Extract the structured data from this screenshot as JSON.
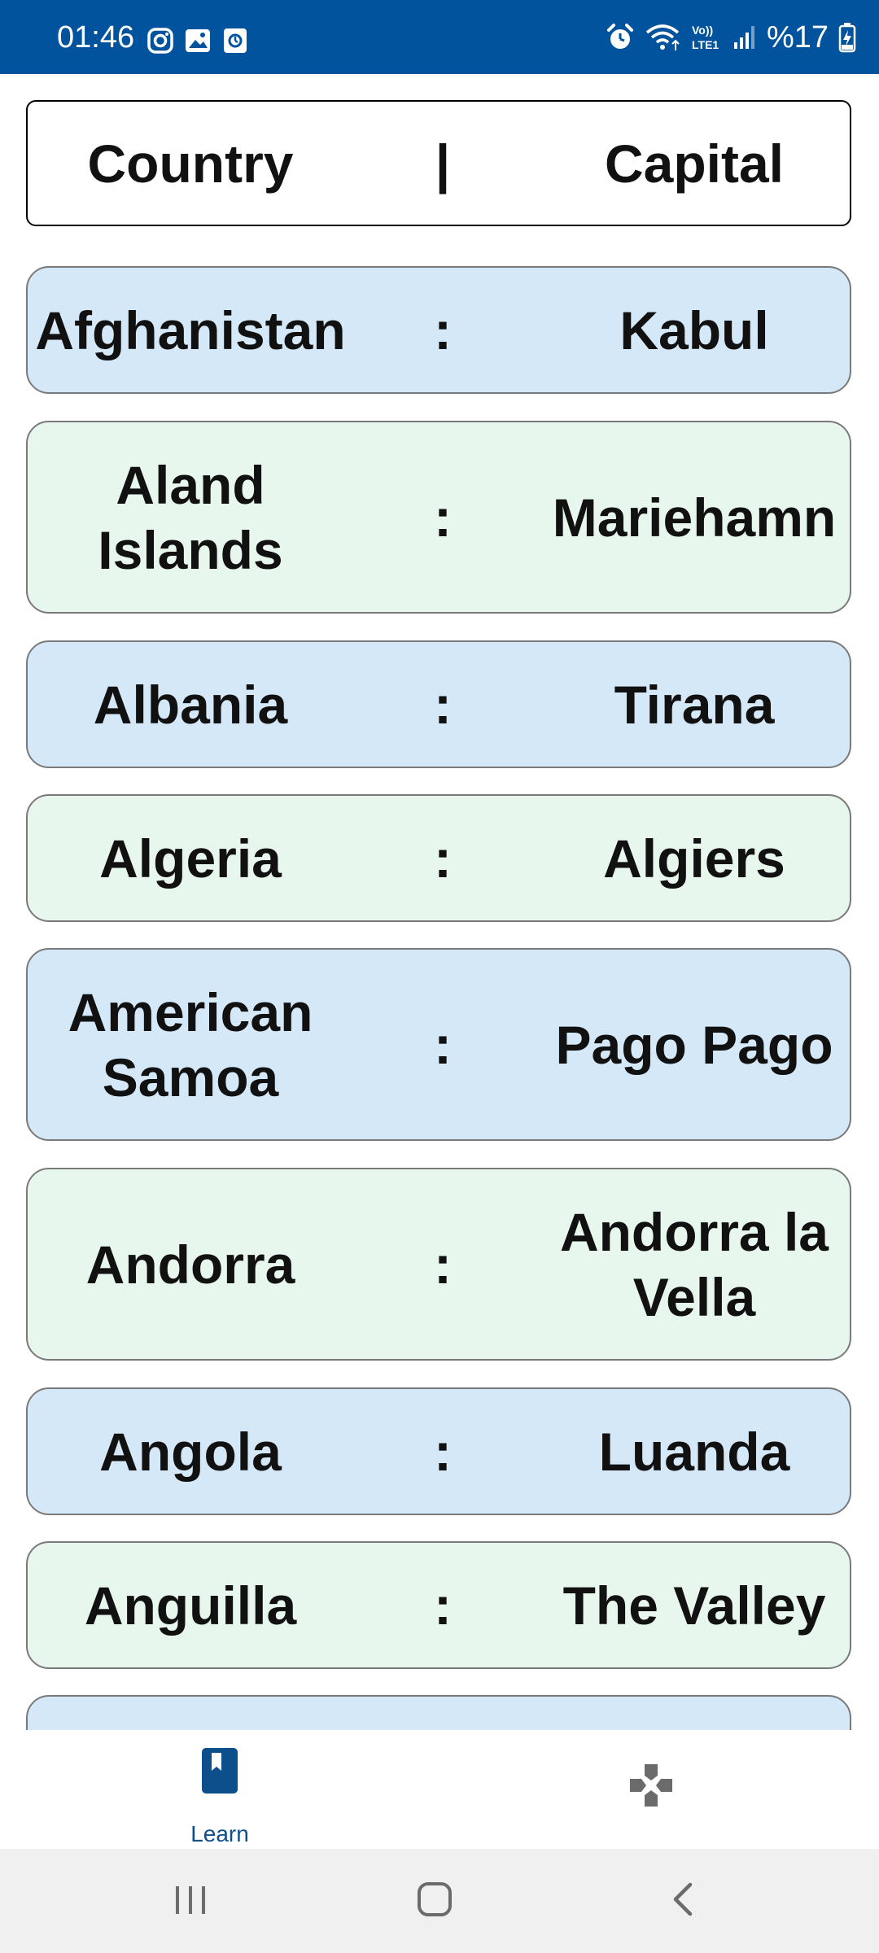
{
  "status_bar": {
    "time": "01:46",
    "battery": "%17",
    "left_icons": [
      "instagram-icon",
      "gallery-icon",
      "screen-record-icon"
    ],
    "right_icons": [
      "alarm-icon",
      "wifi-icon",
      "volte-icon",
      "signal-icon",
      "battery-charging-icon"
    ],
    "volte_label_top": "Vo))",
    "volte_label_bottom": "LTE1",
    "background": "#02539e"
  },
  "header": {
    "country_label": "Country",
    "separator": "|",
    "capital_label": "Capital"
  },
  "rows": [
    {
      "country": "Afghanistan",
      "sep": ":",
      "capital": "Kabul"
    },
    {
      "country": "Aland Islands",
      "sep": ":",
      "capital": "Mariehamn"
    },
    {
      "country": "Albania",
      "sep": ":",
      "capital": "Tirana"
    },
    {
      "country": "Algeria",
      "sep": ":",
      "capital": "Algiers"
    },
    {
      "country": "American Samoa",
      "sep": ":",
      "capital": "Pago Pago"
    },
    {
      "country": "Andorra",
      "sep": ":",
      "capital": "Andorra la Vella"
    },
    {
      "country": "Angola",
      "sep": ":",
      "capital": "Luanda"
    },
    {
      "country": "Anguilla",
      "sep": ":",
      "capital": "The Valley"
    }
  ],
  "colors": {
    "row_blue": "#d5e8f7",
    "row_green": "#e8f7ee",
    "nav_active": "#0c4f8a",
    "nav_inactive": "#6b6b6b"
  },
  "bottom_nav": {
    "learn_label": "Learn",
    "learn_icon": "book-icon",
    "game_icon": "gamepad-icon"
  },
  "system_nav": {
    "icons": [
      "recent-apps-icon",
      "home-icon",
      "back-icon"
    ]
  }
}
